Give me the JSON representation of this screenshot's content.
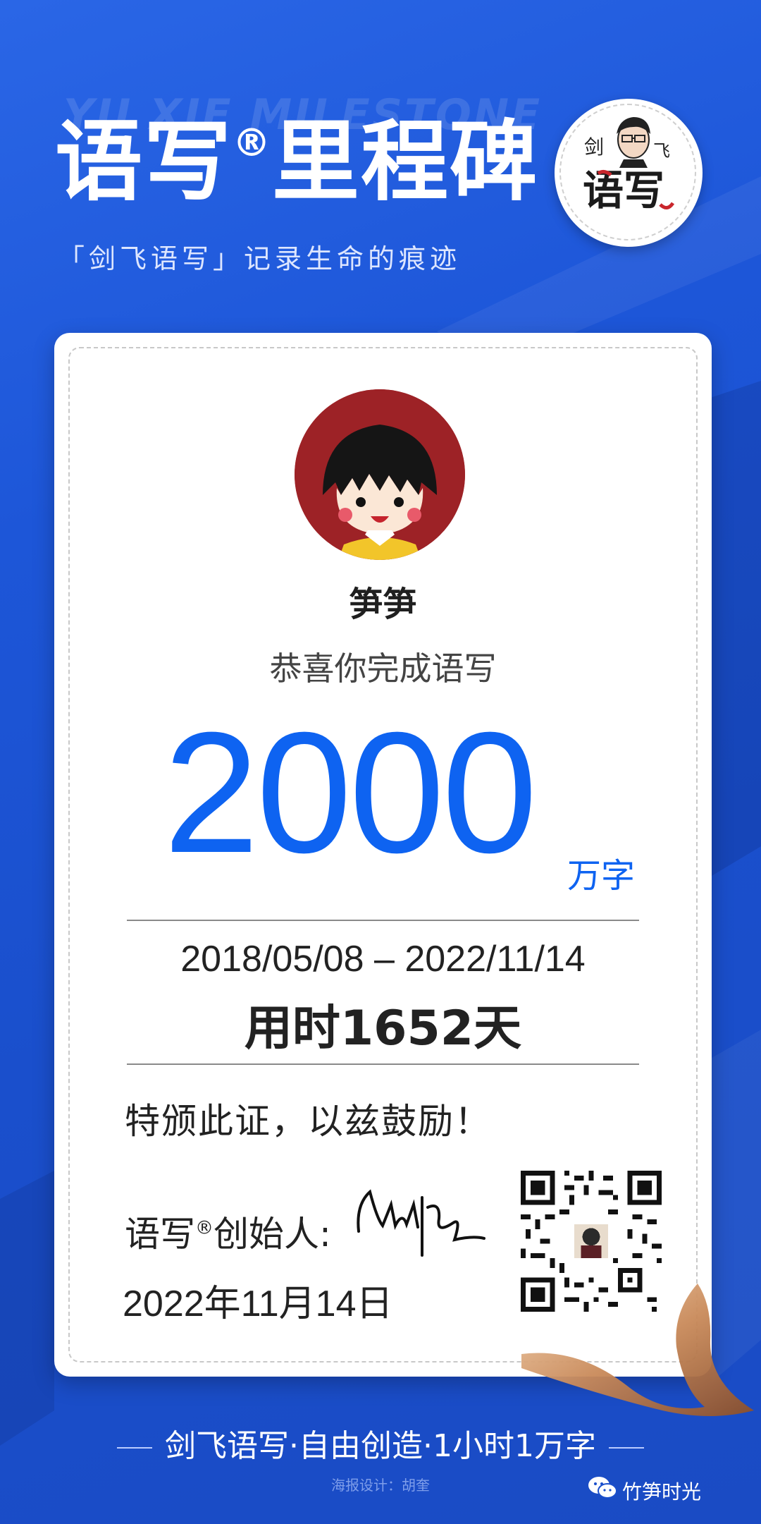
{
  "header": {
    "ghost_text": "YU XIE MILESTONE",
    "title_main": "语写",
    "title_mark": "®",
    "title_rest": "里程碑",
    "subtitle": "「剑飞语写」记录生命的痕迹"
  },
  "logo": {
    "text_left": "剑",
    "text_right": "飞",
    "text_bottom": "语写"
  },
  "card": {
    "name": "笋笋",
    "congrats": "恭喜你完成语写",
    "big_number": "2000",
    "unit": "万字",
    "date_range": "2018/05/08 – 2022/11/14",
    "duration": "用时1652天",
    "award_text": "特颁此证，以兹鼓励！",
    "founder_label_main": "语写",
    "founder_label_mark": "®",
    "founder_label_rest": "创始人:",
    "issue_date": "2022年11月14日"
  },
  "footer": {
    "slogan": "剑飞语写·自由创造·1小时1万字",
    "designer": "海报设计：胡奎",
    "wechat_account": "竹笋时光"
  },
  "colors": {
    "background": "#1a55d4",
    "accent_number": "#0e63f1",
    "card": "#ffffff",
    "avatar_bg": "#9d2226"
  }
}
